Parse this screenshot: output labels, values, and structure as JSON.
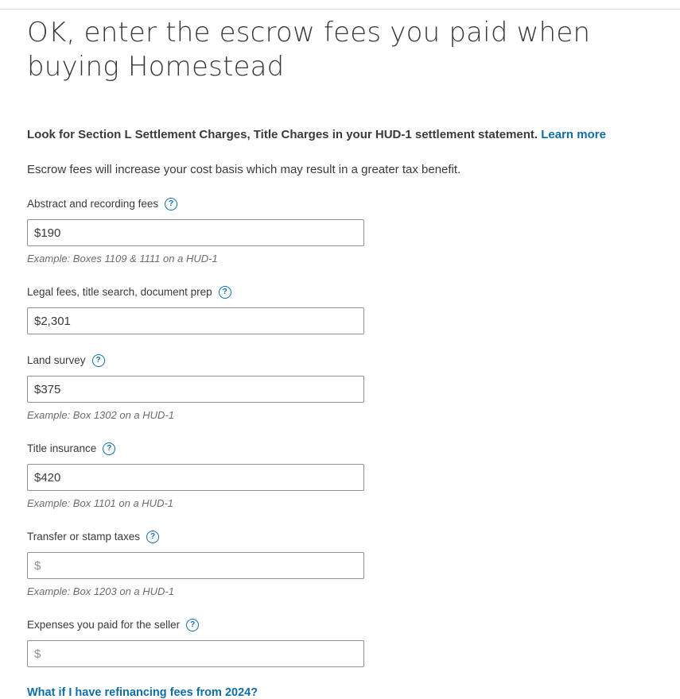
{
  "page": {
    "title": "OK, enter the escrow fees you paid when buying Homestead",
    "look_for_text": "Look for Section L Settlement Charges, Title Charges in your HUD-1 settlement statement.",
    "learn_more_label": "Learn more",
    "intro_text": "Escrow fees will increase your cost basis which may result in a greater tax benefit.",
    "refinancing_link": "What if I have refinancing fees from 2024?"
  },
  "help_icon_glyph": "?",
  "fields": [
    {
      "label": "Abstract and recording fees",
      "value": "$190",
      "example": "Example: Boxes 1109 & 1111 on a HUD-1"
    },
    {
      "label": "Legal fees, title search, document prep",
      "value": "$2,301",
      "example": ""
    },
    {
      "label": "Land survey",
      "value": "$375",
      "example": "Example: Box 1302 on a HUD-1"
    },
    {
      "label": "Title insurance",
      "value": "$420",
      "example": "Example: Box 1101 on a HUD-1"
    },
    {
      "label": "Transfer or stamp taxes",
      "value": "",
      "placeholder": "$",
      "example": "Example: Box 1203 on a HUD-1"
    },
    {
      "label": "Expenses you paid for the seller",
      "value": "",
      "placeholder": "$",
      "example": ""
    }
  ],
  "colors": {
    "link": "#0d6ea8",
    "text": "#393a3d",
    "border": "#8d9096"
  }
}
